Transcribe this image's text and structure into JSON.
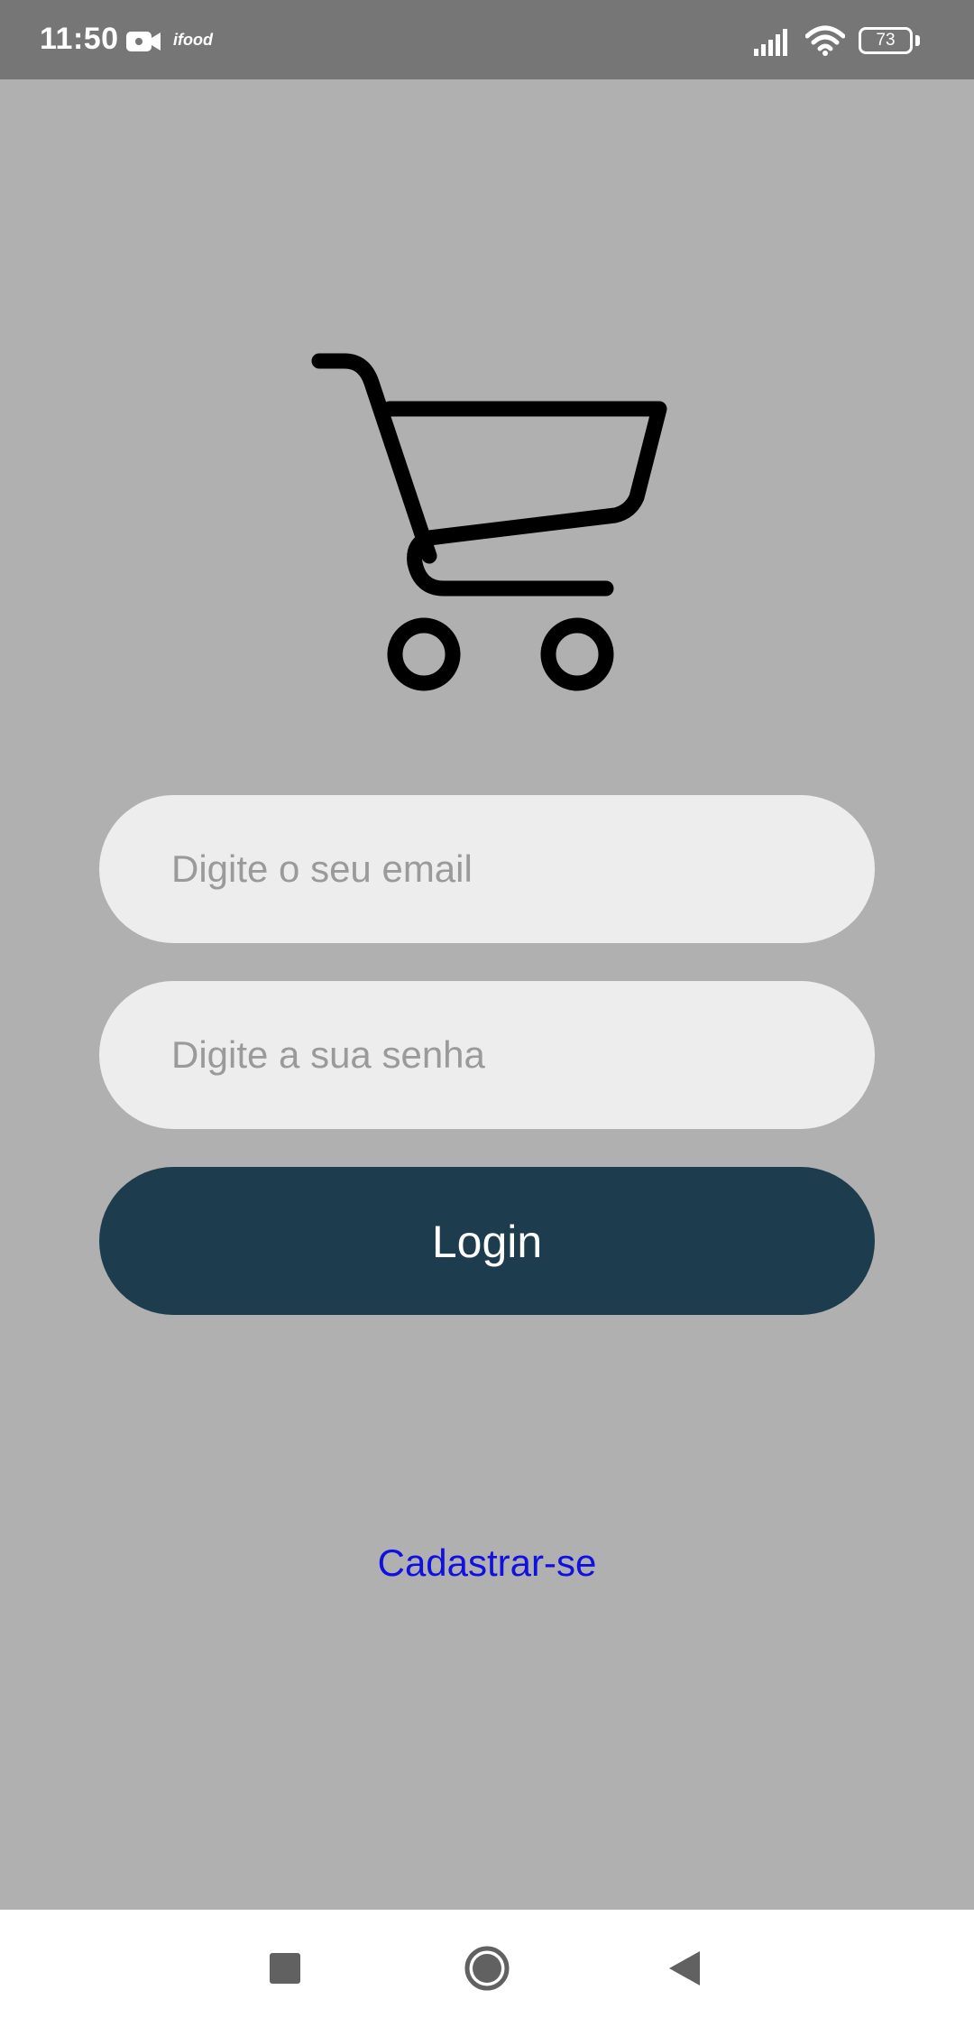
{
  "status_bar": {
    "time": "11:50",
    "app_notification": "ifood",
    "battery_level": "73",
    "icons": [
      "video-camera-icon",
      "ifood-icon",
      "cellular-signal-icon",
      "wifi-icon",
      "battery-icon"
    ]
  },
  "logo": {
    "icon": "shopping-cart-icon"
  },
  "login_form": {
    "email_placeholder": "Digite o seu email",
    "email_value": "",
    "password_placeholder": "Digite a sua senha",
    "password_value": "",
    "login_label": "Login"
  },
  "register": {
    "label": "Cadastrar-se"
  },
  "navigation_bar": {
    "buttons": [
      "recents-square-icon",
      "home-circle-icon",
      "back-triangle-icon"
    ]
  },
  "colors": {
    "background": "#b0b0b0",
    "status_bar": "#767676",
    "input_background": "#ededed",
    "placeholder": "#9a9a9a",
    "login_button": "#1d3d4f",
    "login_text": "#ffffff",
    "link": "#1010e0",
    "nav_bar": "#ffffff"
  }
}
